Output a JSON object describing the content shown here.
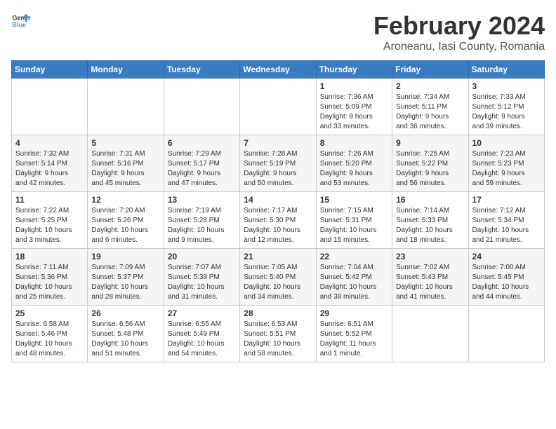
{
  "header": {
    "logo_line1": "General",
    "logo_line2": "Blue",
    "month_title": "February 2024",
    "location": "Aroneanu, Iasi County, Romania"
  },
  "days_of_week": [
    "Sunday",
    "Monday",
    "Tuesday",
    "Wednesday",
    "Thursday",
    "Friday",
    "Saturday"
  ],
  "weeks": [
    [
      {
        "day": "",
        "info": ""
      },
      {
        "day": "",
        "info": ""
      },
      {
        "day": "",
        "info": ""
      },
      {
        "day": "",
        "info": ""
      },
      {
        "day": "1",
        "info": "Sunrise: 7:36 AM\nSunset: 5:09 PM\nDaylight: 9 hours\nand 33 minutes."
      },
      {
        "day": "2",
        "info": "Sunrise: 7:34 AM\nSunset: 5:11 PM\nDaylight: 9 hours\nand 36 minutes."
      },
      {
        "day": "3",
        "info": "Sunrise: 7:33 AM\nSunset: 5:12 PM\nDaylight: 9 hours\nand 39 minutes."
      }
    ],
    [
      {
        "day": "4",
        "info": "Sunrise: 7:32 AM\nSunset: 5:14 PM\nDaylight: 9 hours\nand 42 minutes."
      },
      {
        "day": "5",
        "info": "Sunrise: 7:31 AM\nSunset: 5:16 PM\nDaylight: 9 hours\nand 45 minutes."
      },
      {
        "day": "6",
        "info": "Sunrise: 7:29 AM\nSunset: 5:17 PM\nDaylight: 9 hours\nand 47 minutes."
      },
      {
        "day": "7",
        "info": "Sunrise: 7:28 AM\nSunset: 5:19 PM\nDaylight: 9 hours\nand 50 minutes."
      },
      {
        "day": "8",
        "info": "Sunrise: 7:26 AM\nSunset: 5:20 PM\nDaylight: 9 hours\nand 53 minutes."
      },
      {
        "day": "9",
        "info": "Sunrise: 7:25 AM\nSunset: 5:22 PM\nDaylight: 9 hours\nand 56 minutes."
      },
      {
        "day": "10",
        "info": "Sunrise: 7:23 AM\nSunset: 5:23 PM\nDaylight: 9 hours\nand 59 minutes."
      }
    ],
    [
      {
        "day": "11",
        "info": "Sunrise: 7:22 AM\nSunset: 5:25 PM\nDaylight: 10 hours\nand 3 minutes."
      },
      {
        "day": "12",
        "info": "Sunrise: 7:20 AM\nSunset: 5:26 PM\nDaylight: 10 hours\nand 6 minutes."
      },
      {
        "day": "13",
        "info": "Sunrise: 7:19 AM\nSunset: 5:28 PM\nDaylight: 10 hours\nand 9 minutes."
      },
      {
        "day": "14",
        "info": "Sunrise: 7:17 AM\nSunset: 5:30 PM\nDaylight: 10 hours\nand 12 minutes."
      },
      {
        "day": "15",
        "info": "Sunrise: 7:15 AM\nSunset: 5:31 PM\nDaylight: 10 hours\nand 15 minutes."
      },
      {
        "day": "16",
        "info": "Sunrise: 7:14 AM\nSunset: 5:33 PM\nDaylight: 10 hours\nand 18 minutes."
      },
      {
        "day": "17",
        "info": "Sunrise: 7:12 AM\nSunset: 5:34 PM\nDaylight: 10 hours\nand 21 minutes."
      }
    ],
    [
      {
        "day": "18",
        "info": "Sunrise: 7:11 AM\nSunset: 5:36 PM\nDaylight: 10 hours\nand 25 minutes."
      },
      {
        "day": "19",
        "info": "Sunrise: 7:09 AM\nSunset: 5:37 PM\nDaylight: 10 hours\nand 28 minutes."
      },
      {
        "day": "20",
        "info": "Sunrise: 7:07 AM\nSunset: 5:39 PM\nDaylight: 10 hours\nand 31 minutes."
      },
      {
        "day": "21",
        "info": "Sunrise: 7:05 AM\nSunset: 5:40 PM\nDaylight: 10 hours\nand 34 minutes."
      },
      {
        "day": "22",
        "info": "Sunrise: 7:04 AM\nSunset: 5:42 PM\nDaylight: 10 hours\nand 38 minutes."
      },
      {
        "day": "23",
        "info": "Sunrise: 7:02 AM\nSunset: 5:43 PM\nDaylight: 10 hours\nand 41 minutes."
      },
      {
        "day": "24",
        "info": "Sunrise: 7:00 AM\nSunset: 5:45 PM\nDaylight: 10 hours\nand 44 minutes."
      }
    ],
    [
      {
        "day": "25",
        "info": "Sunrise: 6:58 AM\nSunset: 5:46 PM\nDaylight: 10 hours\nand 48 minutes."
      },
      {
        "day": "26",
        "info": "Sunrise: 6:56 AM\nSunset: 5:48 PM\nDaylight: 10 hours\nand 51 minutes."
      },
      {
        "day": "27",
        "info": "Sunrise: 6:55 AM\nSunset: 5:49 PM\nDaylight: 10 hours\nand 54 minutes."
      },
      {
        "day": "28",
        "info": "Sunrise: 6:53 AM\nSunset: 5:51 PM\nDaylight: 10 hours\nand 58 minutes."
      },
      {
        "day": "29",
        "info": "Sunrise: 6:51 AM\nSunset: 5:52 PM\nDaylight: 11 hours\nand 1 minute."
      },
      {
        "day": "",
        "info": ""
      },
      {
        "day": "",
        "info": ""
      }
    ]
  ]
}
